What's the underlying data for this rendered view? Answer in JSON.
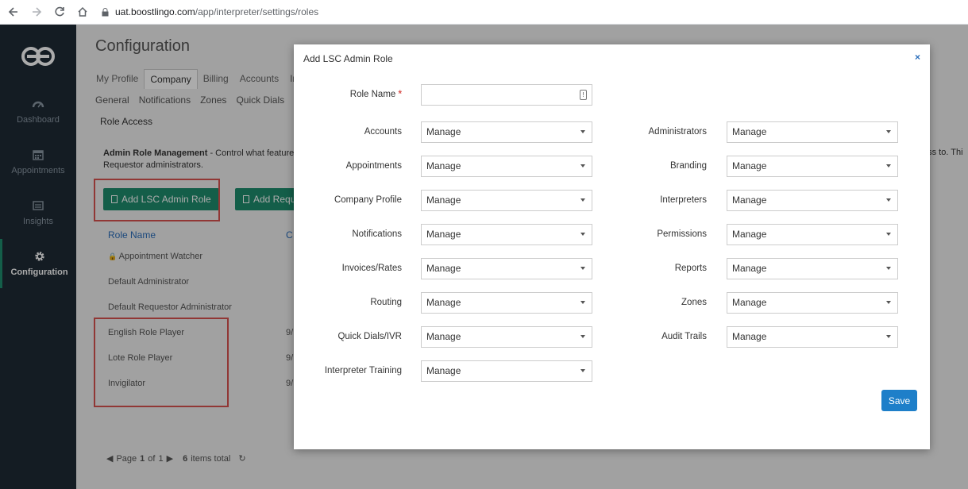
{
  "browser": {
    "url_host": "uat.boostlingo.com",
    "url_path": "/app/interpreter/settings/roles"
  },
  "sidebar": {
    "items": [
      {
        "label": "Dashboard",
        "icon": "dashboard-icon"
      },
      {
        "label": "Appointments",
        "icon": "calendar-icon"
      },
      {
        "label": "Insights",
        "icon": "insights-icon"
      },
      {
        "label": "Configuration",
        "icon": "gear-icon"
      }
    ]
  },
  "page": {
    "title": "Configuration",
    "tabs": [
      "My Profile",
      "Company",
      "Billing",
      "Accounts",
      "In"
    ],
    "subtabs": [
      "General",
      "Notifications",
      "Zones",
      "Quick Dials"
    ],
    "section": "Role Access",
    "desc_bold": "Admin Role Management",
    "desc_text": " - Control what features",
    "desc_line2": "Requestor administrators.",
    "desc_right": "ess to. Thi",
    "add_lsc_button": "Add LSC Admin Role",
    "add_req_button": "Add Requ",
    "col_role": "Role Name",
    "col_c": "C",
    "roles": [
      {
        "name": "Appointment Watcher",
        "date": ""
      },
      {
        "name": "Default Administrator",
        "date": ""
      },
      {
        "name": "Default Requestor Administrator",
        "date": ""
      },
      {
        "name": "English Role Player",
        "date": "9/"
      },
      {
        "name": "Lote Role Player",
        "date": "9/"
      },
      {
        "name": "Invigilator",
        "date": "9/"
      }
    ],
    "pager": {
      "page_label": "Page",
      "page_current": "1",
      "of_label": "of",
      "page_total": "1",
      "items_count": "6",
      "items_label": "items total"
    }
  },
  "modal": {
    "title": "Add LSC Admin Role",
    "close": "×",
    "role_name_label": "Role Name",
    "required_mark": "*",
    "role_name_value": "",
    "left_fields": [
      {
        "label": "Accounts",
        "value": "Manage"
      },
      {
        "label": "Appointments",
        "value": "Manage"
      },
      {
        "label": "Company Profile",
        "value": "Manage"
      },
      {
        "label": "Notifications",
        "value": "Manage"
      },
      {
        "label": "Invoices/Rates",
        "value": "Manage"
      },
      {
        "label": "Routing",
        "value": "Manage"
      },
      {
        "label": "Quick Dials/IVR",
        "value": "Manage"
      },
      {
        "label": "Interpreter Training",
        "value": "Manage"
      }
    ],
    "right_fields": [
      {
        "label": "Administrators",
        "value": "Manage"
      },
      {
        "label": "Branding",
        "value": "Manage"
      },
      {
        "label": "Interpreters",
        "value": "Manage"
      },
      {
        "label": "Permissions",
        "value": "Manage"
      },
      {
        "label": "Reports",
        "value": "Manage"
      },
      {
        "label": "Zones",
        "value": "Manage"
      },
      {
        "label": "Audit Trails",
        "value": "Manage"
      }
    ],
    "save_label": "Save"
  },
  "colors": {
    "sidebar": "#1e2a35",
    "green": "#1e8c6e",
    "blue": "#1e7fc9",
    "highlight": "#d9534f"
  }
}
